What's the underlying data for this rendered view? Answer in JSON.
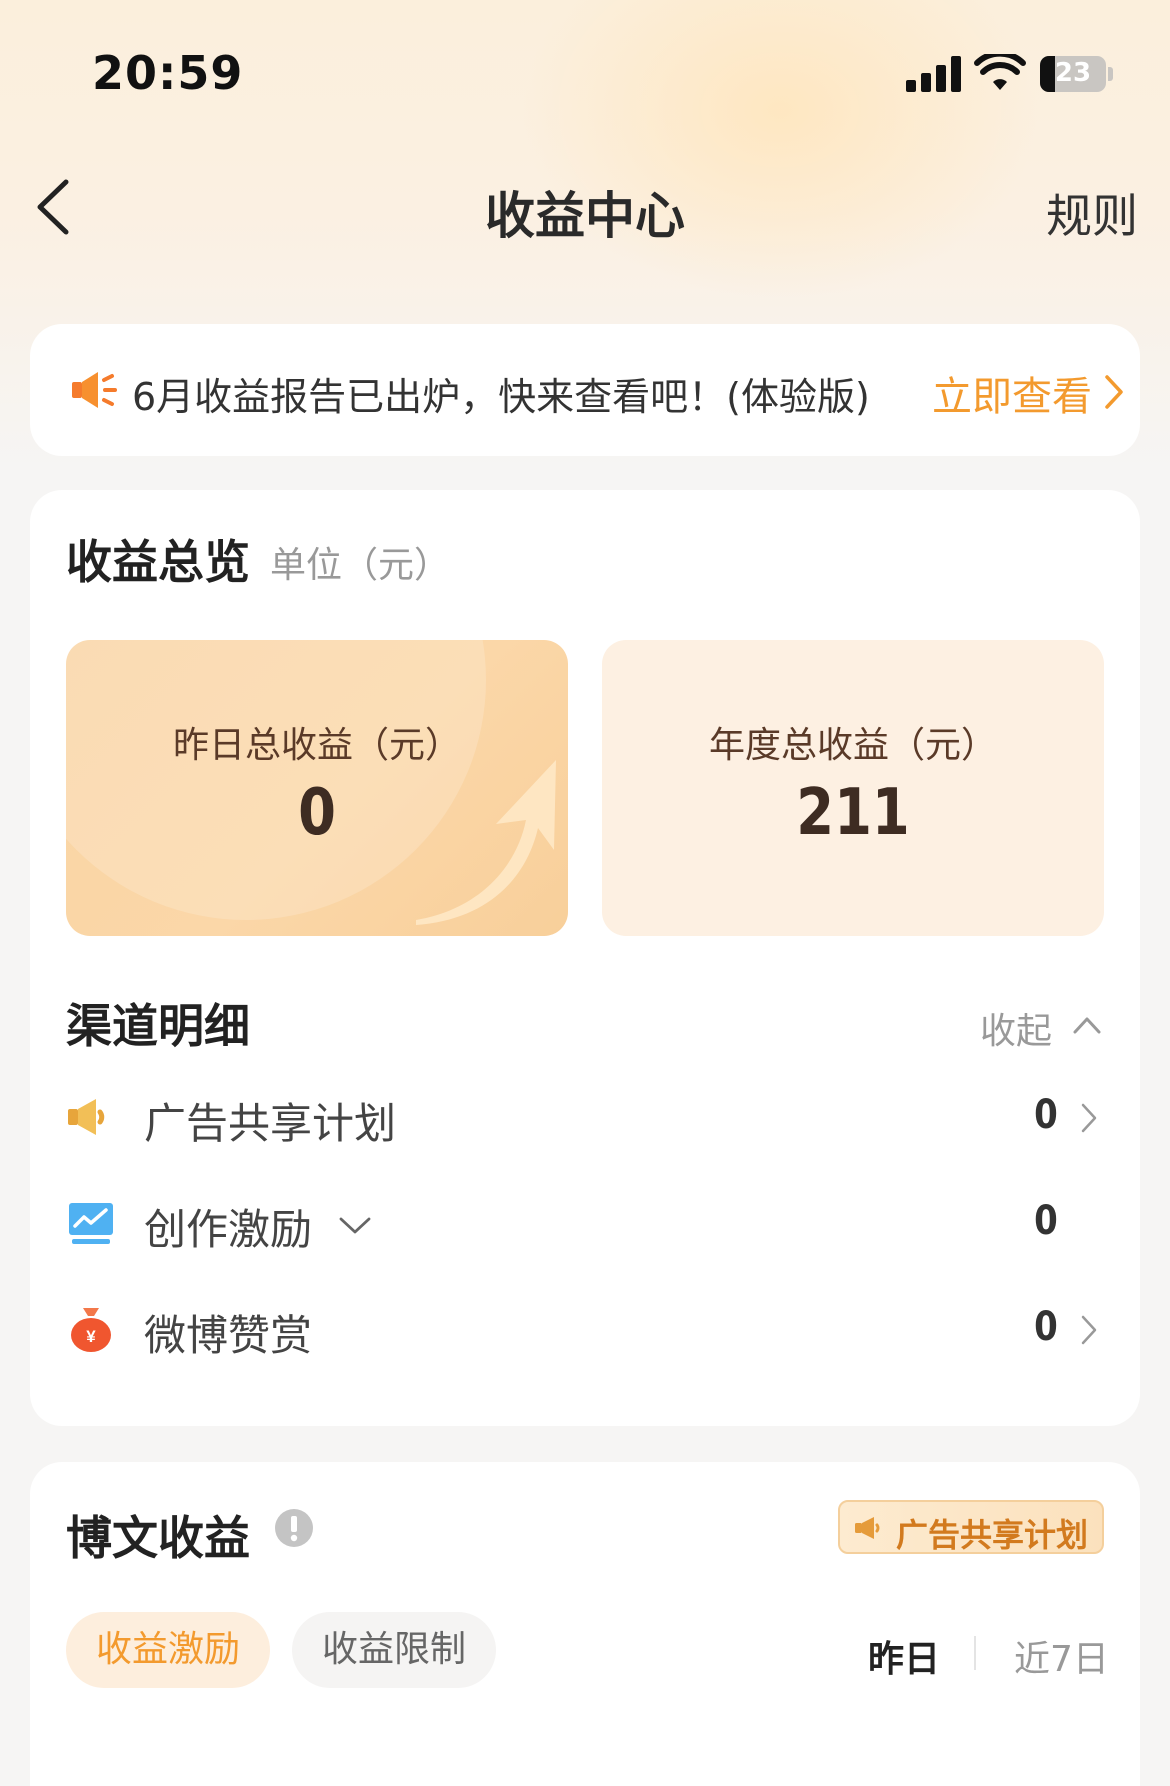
{
  "status_bar": {
    "time": "20:59",
    "battery": "23",
    "battery_level": 0.23
  },
  "nav": {
    "title": "收益中心",
    "rules_label": "规则",
    "back_icon": "chevron-left-icon"
  },
  "notice": {
    "icon": "megaphone-icon",
    "text": "6月收益报告已出炉，快来查看吧！(体验版)",
    "link_label": "立即查看",
    "link_color": "#f39a2e"
  },
  "overview": {
    "title": "收益总览",
    "unit": "单位（元）",
    "yesterday": {
      "label": "昨日总收益（元）",
      "value": "0"
    },
    "annual": {
      "label": "年度总收益（元）",
      "value": "211"
    }
  },
  "channels": {
    "title": "渠道明细",
    "collapse_label": "收起",
    "items": [
      {
        "label": "广告共享计划",
        "value": "0",
        "icon": "megaphone-icon",
        "has_chevron": true
      },
      {
        "label": "创作激励",
        "value": "0",
        "icon": "chart-monitor-icon",
        "has_chevron": false
      },
      {
        "label": "微博赞赏",
        "value": "0",
        "icon": "money-bag-icon",
        "has_chevron": true
      }
    ]
  },
  "blog": {
    "title": "博文收益",
    "badge_label": "广告共享计划",
    "tabs": [
      {
        "label": "收益激励",
        "active": true
      },
      {
        "label": "收益限制",
        "active": false
      }
    ],
    "ranges": [
      {
        "label": "昨日",
        "active": true
      },
      {
        "label": "近7日",
        "active": false
      }
    ]
  },
  "colors": {
    "accent": "#f39a2e",
    "card": "#ffffff",
    "page_bg": "#f6f5f4"
  }
}
